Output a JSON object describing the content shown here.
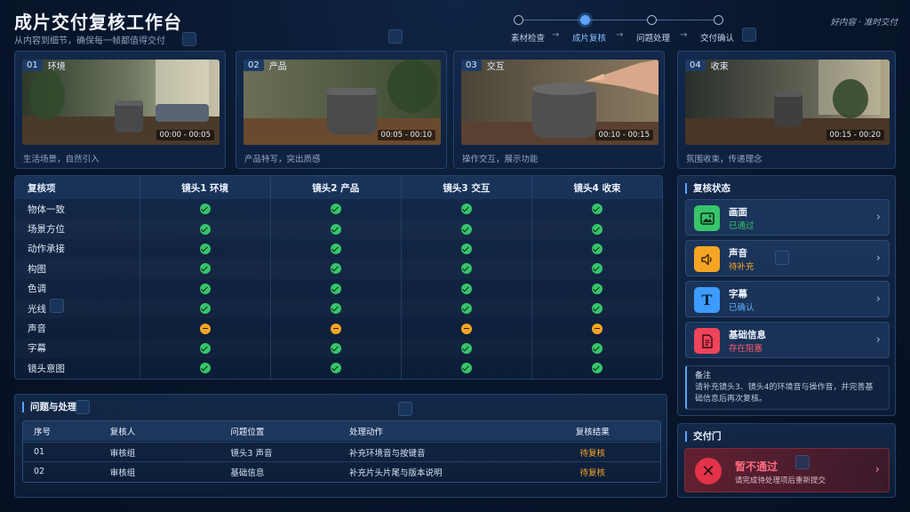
{
  "header": {
    "title": "成片交付复核工作台",
    "subtitle": "从内容到细节，确保每一帧都值得交付",
    "tagline": "好内容 · 准时交付"
  },
  "stepper": {
    "steps": [
      "素材检查",
      "成片复核",
      "问题处理",
      "交付确认"
    ],
    "active": "成片复核",
    "separator": "→"
  },
  "shots": [
    {
      "num": "01",
      "name": "环境",
      "time": "00:00 - 00:05",
      "caption": "生活场景，自然引入"
    },
    {
      "num": "02",
      "name": "产品",
      "time": "00:05 - 00:10",
      "caption": "产品特写，突出质感"
    },
    {
      "num": "03",
      "name": "交互",
      "time": "00:10 - 00:15",
      "caption": "操作交互，展示功能"
    },
    {
      "num": "04",
      "name": "收束",
      "time": "00:15 - 00:20",
      "caption": "氛围收束，传递理念"
    }
  ],
  "review": {
    "columns": [
      "复核项",
      "镜头1  环境",
      "镜头2  产品",
      "镜头3  交互",
      "镜头4  收束"
    ],
    "rows": [
      {
        "item": "物体一致",
        "marks": [
          "ok",
          "ok",
          "ok",
          "ok"
        ]
      },
      {
        "item": "场景方位",
        "marks": [
          "ok",
          "ok",
          "ok",
          "ok"
        ]
      },
      {
        "item": "动作承接",
        "marks": [
          "ok",
          "ok",
          "ok",
          "ok"
        ]
      },
      {
        "item": "构图",
        "marks": [
          "ok",
          "ok",
          "ok",
          "ok"
        ]
      },
      {
        "item": "色调",
        "marks": [
          "ok",
          "ok",
          "ok",
          "ok"
        ]
      },
      {
        "item": "光线",
        "marks": [
          "ok",
          "ok",
          "ok",
          "ok"
        ]
      },
      {
        "item": "声音",
        "marks": [
          "pending",
          "pending",
          "pending",
          "pending"
        ]
      },
      {
        "item": "字幕",
        "marks": [
          "ok",
          "ok",
          "ok",
          "ok"
        ]
      },
      {
        "item": "镜头意图",
        "marks": [
          "ok",
          "ok",
          "ok",
          "ok"
        ]
      }
    ]
  },
  "issues": {
    "title": "问题与处理",
    "columns": [
      "序号",
      "复核人",
      "问题位置",
      "处理动作",
      "复核结果"
    ],
    "rows": [
      {
        "no": "01",
        "reviewer": "审核组",
        "location": "镜头3  声音",
        "action": "补充环境音与按键音",
        "result": "待复核"
      },
      {
        "no": "02",
        "reviewer": "审核组",
        "location": "基础信息",
        "action": "补充片头片尾与版本说明",
        "result": "待复核"
      }
    ]
  },
  "status": {
    "title": "复核状态",
    "items": [
      {
        "label": "画面",
        "value": "已通过",
        "icon": "image-icon",
        "color": "#37c56b"
      },
      {
        "label": "声音",
        "value": "待补充",
        "icon": "speaker-icon",
        "color": "#f5a524"
      },
      {
        "label": "字幕",
        "value": "已确认",
        "icon": "text-icon",
        "color": "#3d9bff"
      },
      {
        "label": "基础信息",
        "value": "存在阻塞",
        "icon": "document-icon",
        "color": "#ef4459"
      }
    ],
    "note_title": "备注",
    "note_text": "请补充镜头3、镜头4的环境音与操作音，并完善基础信息后再次复核。"
  },
  "gate": {
    "title": "交付门",
    "status": "暂不通过",
    "hint": "请完成待处理项后重新提交"
  }
}
